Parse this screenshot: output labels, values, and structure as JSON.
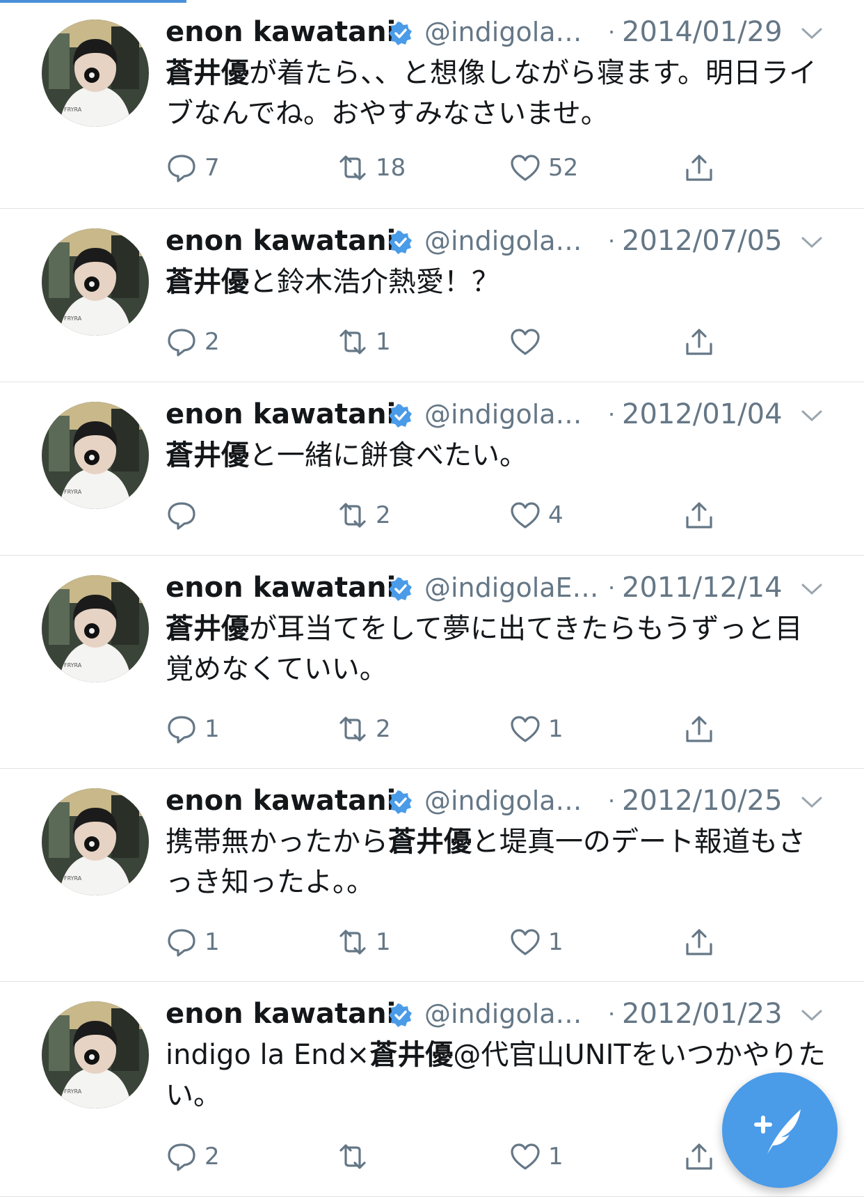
{
  "colors": {
    "accent": "#4a9be8",
    "text": "#14171a",
    "muted": "#657786",
    "divider": "#dfe3e6"
  },
  "tweets": [
    {
      "name": "enon kawatani",
      "handle": "@indigola…",
      "dot": "·",
      "date": "2014/01/29",
      "bold": "蒼井優",
      "text_before": "",
      "text_after": "が着たら、、と想像しながら寝ます。明日ライブなんでね。おやすみなさいませ。",
      "replies": "7",
      "retweets": "18",
      "likes": "52"
    },
    {
      "name": "enon kawatani",
      "handle": "@indigola…",
      "dot": "·",
      "date": "2012/07/05",
      "bold": "蒼井優",
      "text_before": "",
      "text_after": "と鈴木浩介熱愛！？",
      "replies": "2",
      "retweets": "1",
      "likes": ""
    },
    {
      "name": "enon kawatani",
      "handle": "@indigola…",
      "dot": "·",
      "date": "2012/01/04",
      "bold": "蒼井優",
      "text_before": "",
      "text_after": "と一緒に餅食べたい。",
      "replies": "",
      "retweets": "2",
      "likes": "4"
    },
    {
      "name": "enon kawatani",
      "handle": "@indigolaE…",
      "dot": "·",
      "date": "2011/12/14",
      "bold": "蒼井優",
      "text_before": "",
      "text_after": "が耳当てをして夢に出てきたらもうずっと目覚めなくていい。",
      "replies": "1",
      "retweets": "2",
      "likes": "1"
    },
    {
      "name": "enon kawatani",
      "handle": "@indigola…",
      "dot": "·",
      "date": "2012/10/25",
      "bold": "蒼井優",
      "text_before": "携帯無かったから",
      "text_after": "と堤真一のデート報道もさっき知ったよ。。",
      "replies": "1",
      "retweets": "1",
      "likes": "1"
    },
    {
      "name": "enon kawatani",
      "handle": "@indigola…",
      "dot": "·",
      "date": "2012/01/23",
      "bold": "蒼井優",
      "text_before": "indigo la End×",
      "text_after": "@代官山UNITをいつかやりたい。",
      "replies": "2",
      "retweets": "",
      "likes": "1"
    }
  ],
  "icons": {
    "reply": "reply-icon",
    "retweet": "retweet-icon",
    "like": "heart-icon",
    "share": "share-icon",
    "verified": "verified-badge-icon",
    "menu": "chevron-down-icon",
    "compose": "compose-tweet-icon"
  }
}
